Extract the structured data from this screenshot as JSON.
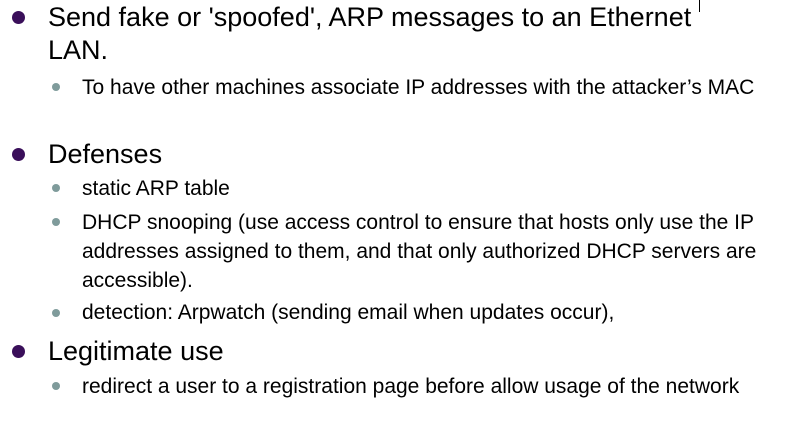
{
  "bullets": [
    {
      "text": "Send fake or 'spoofed', ARP messages to an Ethernet LAN.",
      "sub": [
        "To have other machines associate IP addresses with the attacker’s MAC"
      ]
    },
    {
      "text": "Defenses",
      "sub": [
        "static ARP table",
        "DHCP snooping (use access control to ensure that hosts only use the IP addresses assigned to them, and that only authorized DHCP servers are accessible).",
        "detection: Arpwatch (sending email when updates occur),"
      ]
    },
    {
      "text": "Legitimate use",
      "sub": [
        "redirect a user to a registration page before allow usage of the network"
      ]
    }
  ],
  "colors": {
    "main_bullet": "#3a0f5a",
    "sub_bullet": "#7f9b9b"
  }
}
